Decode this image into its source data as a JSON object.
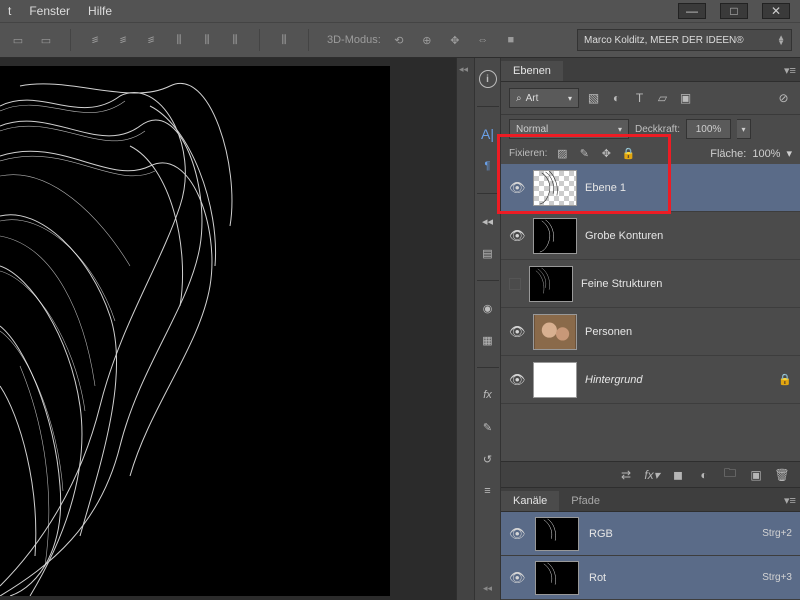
{
  "menu": {
    "item1": "t",
    "fenster": "Fenster",
    "hilfe": "Hilfe"
  },
  "window": {
    "min": "—",
    "max": "□",
    "close": "✕"
  },
  "optbar": {
    "mode3d_label": "3D-Modus:",
    "user": "Marco Kolditz, MEER DER IDEEN®"
  },
  "layers_panel": {
    "tab": "Ebenen",
    "filter_kind_icon": "⌕",
    "filter_kind_label": "Art",
    "blend_mode": "Normal",
    "opacity_label": "Deckkraft:",
    "opacity_value": "100%",
    "fill_label": "Fläche:",
    "fill_value": "100%",
    "lock_label": "Fixieren:",
    "layers": [
      {
        "name": "Ebene 1",
        "visible": true,
        "selected": true,
        "thumb": "checker_art"
      },
      {
        "name": "Grobe Konturen",
        "visible": true,
        "selected": false,
        "thumb": "black_art"
      },
      {
        "name": "Feine Strukturen",
        "visible": false,
        "selected": false,
        "thumb": "black_art"
      },
      {
        "name": "Personen",
        "visible": true,
        "selected": false,
        "thumb": "photo"
      },
      {
        "name": "Hintergrund",
        "visible": true,
        "selected": false,
        "thumb": "white",
        "locked": true,
        "italic": true
      }
    ]
  },
  "channels_panel": {
    "tab1": "Kanäle",
    "tab2": "Pfade",
    "channels": [
      {
        "name": "RGB",
        "shortcut": "Strg+2"
      },
      {
        "name": "Rot",
        "shortcut": "Strg+3"
      }
    ]
  }
}
